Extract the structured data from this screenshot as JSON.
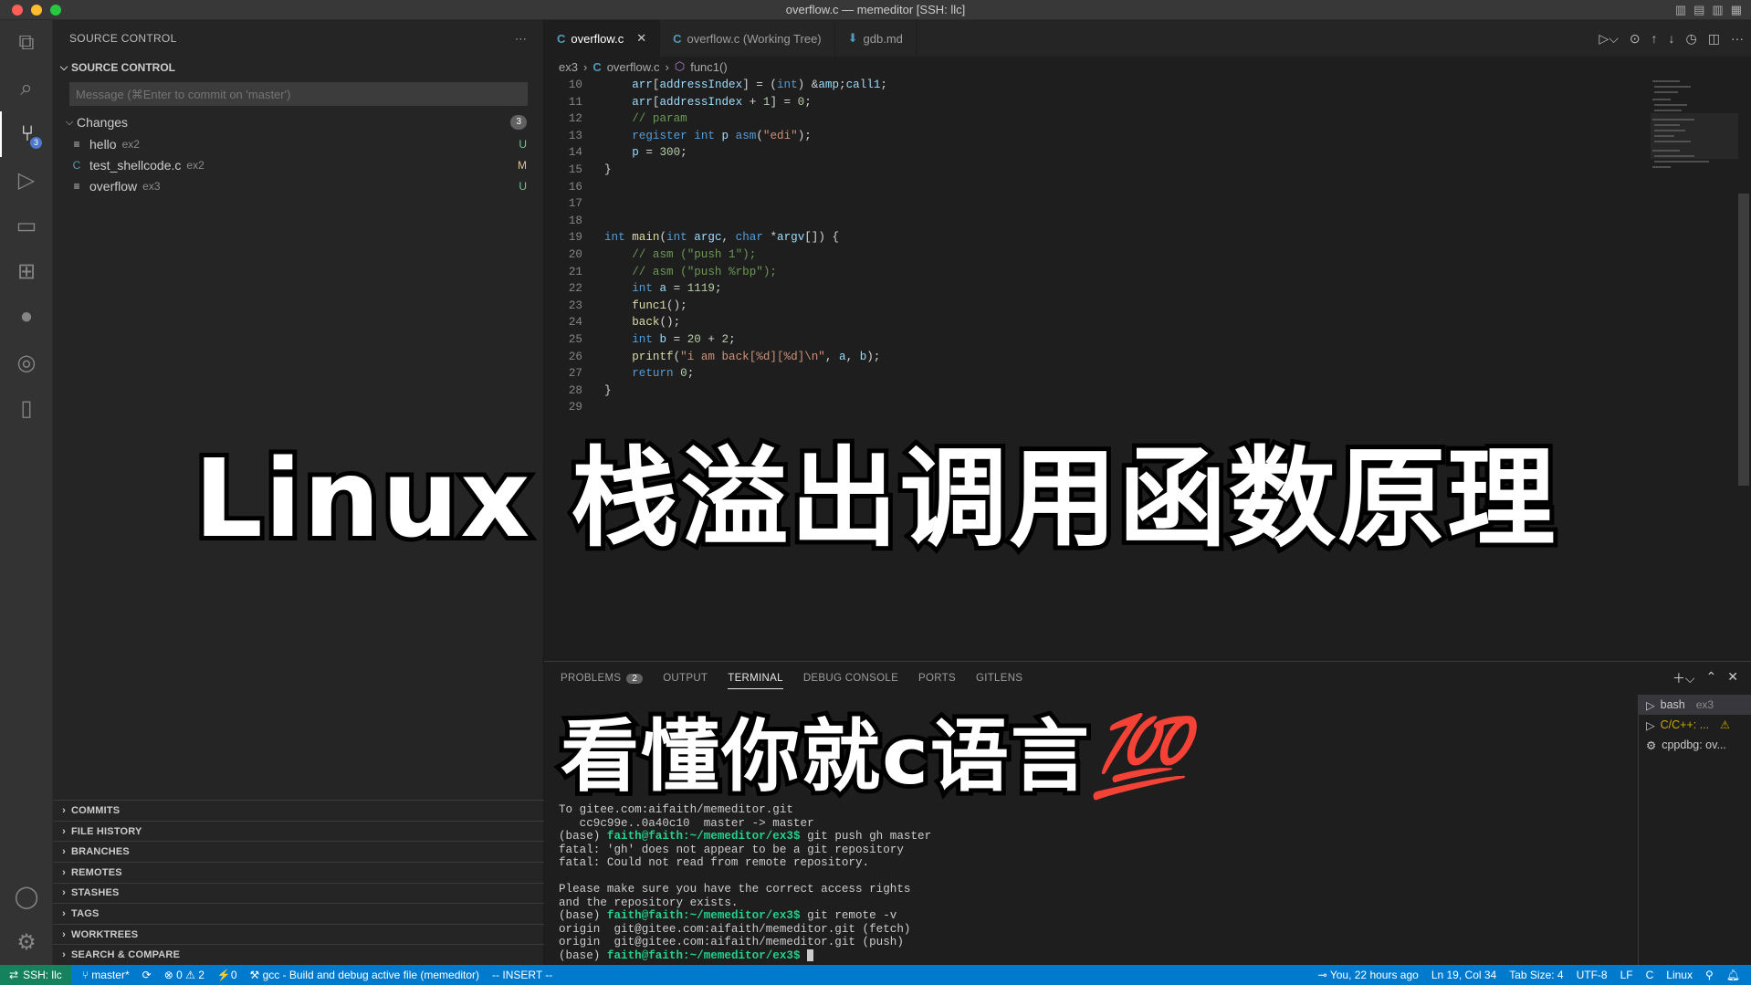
{
  "window": {
    "title": "overflow.c — memeditor [SSH: llc]"
  },
  "colors": {
    "accent": "#007acc",
    "remote": "#16825d",
    "untracked": "#73c991",
    "modified": "#e2c08d",
    "badge": "#4d78cc"
  },
  "activity_bar": {
    "source_control_badge": "3"
  },
  "sidebar": {
    "view_title": "SOURCE CONTROL",
    "more": "···",
    "section": "SOURCE CONTROL",
    "commit_placeholder": "Message (⌘Enter to commit on 'master')",
    "changes_label": "Changes",
    "changes_count": "3",
    "files": [
      {
        "icon": "≡",
        "name": "hello",
        "dir": "ex2",
        "status": "U"
      },
      {
        "icon": "C",
        "name": "test_shellcode.c",
        "dir": "ex2",
        "status": "M"
      },
      {
        "icon": "≡",
        "name": "overflow",
        "dir": "ex3",
        "status": "U"
      }
    ],
    "bottom_sections": [
      "COMMITS",
      "FILE HISTORY",
      "BRANCHES",
      "REMOTES",
      "STASHES",
      "TAGS",
      "WORKTREES",
      "SEARCH & COMPARE"
    ]
  },
  "editor": {
    "tabs": [
      {
        "icon": "C",
        "label": "overflow.c",
        "close": "✕"
      },
      {
        "icon": "C",
        "label": "overflow.c (Working Tree)"
      },
      {
        "icon": "⬇",
        "label": "gdb.md"
      }
    ],
    "breadcrumb": {
      "folder": "ex3",
      "file": "overflow.c",
      "symbol": "func1()"
    },
    "lines": [
      {
        "n": "10",
        "t": "    arr[addressIndex] = (int) &call1;"
      },
      {
        "n": "11",
        "t": "    arr[addressIndex + 1] = 0;"
      },
      {
        "n": "12",
        "t": "    // param"
      },
      {
        "n": "13",
        "t": "    register int p asm(\"edi\");"
      },
      {
        "n": "14",
        "t": "    p = 300;"
      },
      {
        "n": "15",
        "t": "}"
      },
      {
        "n": "16",
        "t": ""
      },
      {
        "n": "17",
        "t": ""
      },
      {
        "n": "18",
        "t": ""
      },
      {
        "n": "19",
        "t": "int main(int argc, char *argv[]) {"
      },
      {
        "n": "20",
        "t": "    // asm (\"push 1\");"
      },
      {
        "n": "21",
        "t": "    // asm (\"push %rbp\");"
      },
      {
        "n": "22",
        "t": "    int a = 1119;"
      },
      {
        "n": "23",
        "t": "    func1();"
      },
      {
        "n": "24",
        "t": "    back();"
      },
      {
        "n": "25",
        "t": "    int b = 20 + 2;"
      },
      {
        "n": "26",
        "t": "    printf(\"i am back[%d][%d]\\n\", a, b);"
      },
      {
        "n": "27",
        "t": "    return 0;"
      },
      {
        "n": "28",
        "t": "}"
      },
      {
        "n": "29",
        "t": ""
      }
    ]
  },
  "panel": {
    "tabs": [
      "PROBLEMS",
      "OUTPUT",
      "TERMINAL",
      "DEBUG CONSOLE",
      "PORTS",
      "GITLENS"
    ],
    "problems_count": "2",
    "terminal_lines": [
      "To gitee.com:aifaith/memeditor.git",
      "   cc9c99e..0a40c10  master -> master",
      "(base) faith@faith:~/memeditor/ex3$ git push gh master",
      "fatal: 'gh' does not appear to be a git repository",
      "fatal: Could not read from remote repository.",
      "",
      "Please make sure you have the correct access rights",
      "and the repository exists.",
      "(base) faith@faith:~/memeditor/ex3$ git remote -v",
      "origin  git@gitee.com:aifaith/memeditor.git (fetch)",
      "origin  git@gitee.com:aifaith/memeditor.git (push)",
      "(base) faith@faith:~/memeditor/ex3$ "
    ],
    "terminals": [
      {
        "icon": "▷",
        "label": "bash",
        "sub": "ex3"
      },
      {
        "icon": "▷",
        "label": "C/C++: ...",
        "sub": "⚠"
      },
      {
        "icon": "⚙",
        "label": "cppdbg: ov...",
        "sub": ""
      }
    ]
  },
  "statusbar": {
    "remote": "SSH: llc",
    "branch": "master*",
    "sync": "⟳",
    "problems": "⊗ 0 ⚠ 2",
    "ports": "⚡0",
    "task": "gcc - Build and debug active file (memeditor)",
    "mode": "-- INSERT --",
    "blame": "You, 22 hours ago",
    "position": "Ln 19, Col 34",
    "tab_size": "Tab Size: 4",
    "encoding": "UTF-8",
    "eol": "LF",
    "language": "C",
    "platform": "Linux"
  },
  "overlay": {
    "title": "Linux 栈溢出调用函数原理",
    "subtitle": "看懂你就c语言",
    "emoji": "💯"
  }
}
